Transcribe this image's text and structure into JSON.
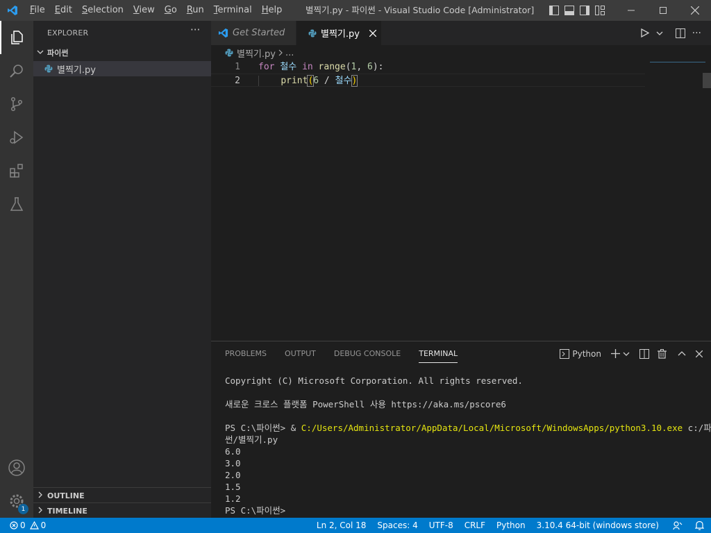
{
  "titlebar": {
    "menus": [
      "File",
      "Edit",
      "Selection",
      "View",
      "Go",
      "Run",
      "Terminal",
      "Help"
    ],
    "title": "별찍기.py - 파이썬 - Visual Studio Code [Administrator]"
  },
  "sidebar": {
    "title": "EXPLORER",
    "more": "···",
    "folder": "파이썬",
    "file": "별찍기.py",
    "outline": "OUTLINE",
    "timeline": "TIMELINE"
  },
  "activity": {
    "badge": "1"
  },
  "tabs": [
    {
      "label": "Get Started"
    },
    {
      "label": "별찍기.py"
    }
  ],
  "breadcrumb": {
    "file": "별찍기.py",
    "rest": "..."
  },
  "editor": {
    "lines": [
      {
        "num": "1",
        "tokens": [
          "for",
          " ",
          "철수",
          " ",
          "in",
          " ",
          "range",
          "(",
          "1",
          ", ",
          "6",
          "):"
        ]
      },
      {
        "num": "2",
        "tokens": [
          "    ",
          "print",
          "(",
          "6",
          " / ",
          "철수",
          ")"
        ]
      }
    ]
  },
  "panel": {
    "tabs": [
      "PROBLEMS",
      "OUTPUT",
      "DEBUG CONSOLE",
      "TERMINAL"
    ],
    "terminal_label": "Python",
    "terminal": {
      "l1": "Copyright (C) Microsoft Corporation. All rights reserved.",
      "l2": "",
      "l3": "새로운 크로스 플랫폼 PowerShell 사용 https://aka.ms/pscore6",
      "l4": "",
      "l5_prompt": "PS C:\\파이썬> & ",
      "l5_path": "C:/Users/Administrator/AppData/Local/Microsoft/WindowsApps/python3.10.exe",
      "l5_arg": " c:/파이",
      "l6": "썬/별찍기.py",
      "out": [
        "6.0",
        "3.0",
        "2.0",
        "1.5",
        "1.2"
      ],
      "last": "PS C:\\파이썬> "
    }
  },
  "status": {
    "errors": "0",
    "warnings": "0",
    "position": "Ln 2, Col 18",
    "spaces": "Spaces: 4",
    "encoding": "UTF-8",
    "eol": "CRLF",
    "language": "Python",
    "interpreter": "3.10.4 64-bit (windows store)"
  }
}
